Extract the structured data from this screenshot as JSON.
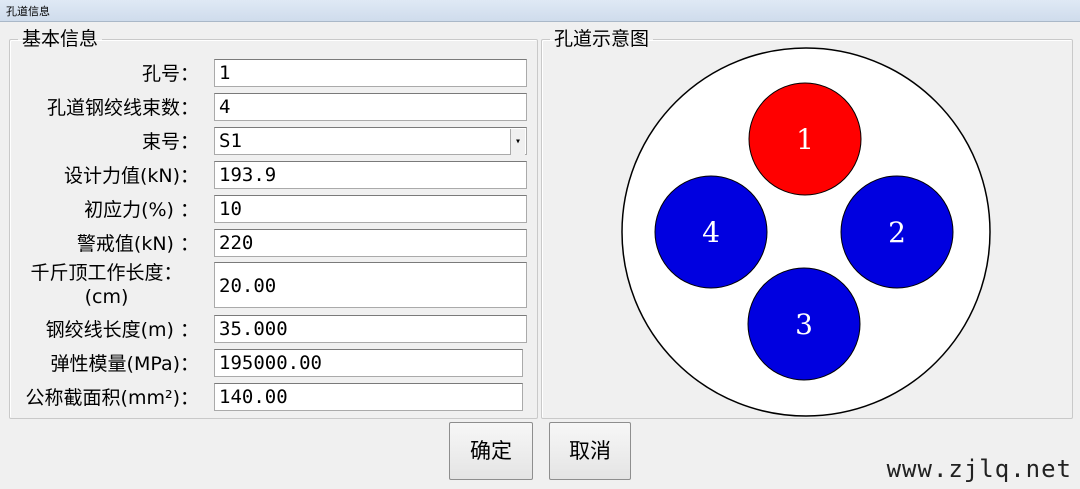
{
  "window": {
    "title": "孔道信息"
  },
  "basic_info": {
    "legend": "基本信息",
    "fields": [
      {
        "label": "孔号：",
        "value": "1"
      },
      {
        "label": "孔道钢绞线束数：",
        "value": "4"
      },
      {
        "label": "束号：",
        "value": "S1"
      },
      {
        "label": "设计力值(kN)：",
        "value": "193.9"
      },
      {
        "label": "初应力(%) ：",
        "value": "10"
      },
      {
        "label": "警戒值(kN) ：",
        "value": "220"
      },
      {
        "label_line1": "千斤顶工作长度：",
        "label_line2": "(cm)",
        "value": "20.00"
      },
      {
        "label": "钢绞线长度(m) ：",
        "value": "35.000"
      },
      {
        "label": "弹性模量(MPa)：",
        "value": "195000.00"
      },
      {
        "label": "公称截面积(mm²)：",
        "value": "140.00"
      }
    ]
  },
  "diagram": {
    "legend": "孔道示意图",
    "strands": [
      {
        "label": "1",
        "color": "#ff0000",
        "selected": true
      },
      {
        "label": "2",
        "color": "#0000e0"
      },
      {
        "label": "3",
        "color": "#0000e0"
      },
      {
        "label": "4",
        "color": "#0000e0"
      }
    ]
  },
  "buttons": {
    "ok": "确定",
    "cancel": "取消"
  },
  "watermark": "www.zjlq.net"
}
